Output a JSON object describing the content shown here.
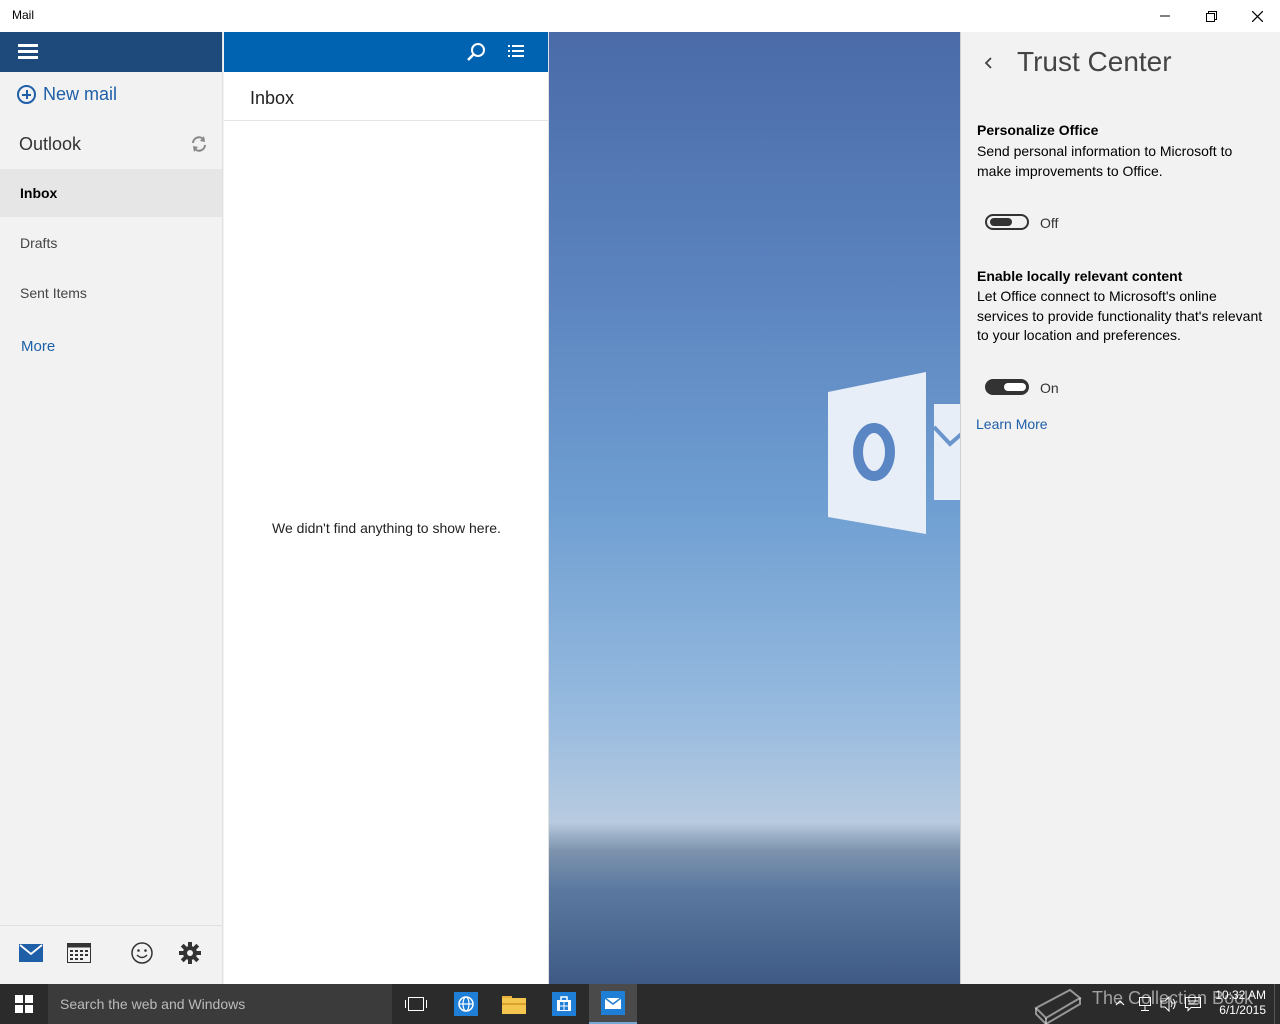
{
  "window": {
    "title": "Mail"
  },
  "nav": {
    "new_mail": "New mail",
    "account": "Outlook",
    "folders": [
      {
        "label": "Inbox",
        "active": true
      },
      {
        "label": "Drafts",
        "active": false
      },
      {
        "label": "Sent Items",
        "active": false
      }
    ],
    "more": "More",
    "bottom_icons": [
      "mail-icon",
      "calendar-icon",
      "feedback-smiley-icon",
      "settings-gear-icon"
    ]
  },
  "list": {
    "title": "Inbox",
    "empty_message": "We didn't find anything to show here."
  },
  "trust_center": {
    "title": "Trust Center",
    "sections": [
      {
        "heading": "Personalize Office",
        "description": "Send personal information to Microsoft to make improvements to Office.",
        "toggle_state": "Off",
        "toggle_on": false
      },
      {
        "heading": "Enable locally relevant content",
        "description": "Let Office connect to Microsoft's online services to provide functionality that's relevant to your location and preferences.",
        "toggle_state": "On",
        "toggle_on": true
      }
    ],
    "learn_more": "Learn More"
  },
  "taskbar": {
    "search_placeholder": "Search the web and Windows",
    "watermark": "The Collection Book",
    "time": "10:32 AM",
    "date": "6/1/2015",
    "apps": [
      "task-view-icon",
      "internet-explorer-icon",
      "file-explorer-icon",
      "store-icon",
      "mail-app-icon"
    ]
  },
  "colors": {
    "nav_header": "#1d4a7a",
    "list_header": "#0063b1",
    "accent_link": "#1e5fa8",
    "taskbar": "#2b2b2b"
  }
}
